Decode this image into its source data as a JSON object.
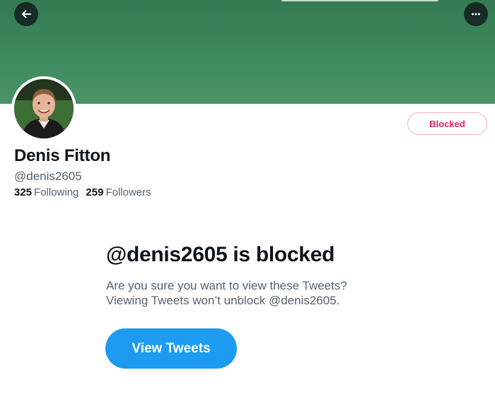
{
  "header": {
    "back_icon": "arrow-left-icon",
    "more_icon": "more-horizontal-icon",
    "banner_color": "#3f8a5f"
  },
  "profile": {
    "name": "Denis Fitton",
    "handle": "@denis2605",
    "following_count": "325",
    "following_label": "Following",
    "followers_count": "259",
    "followers_label": "Followers",
    "blocked_button_label": "Blocked",
    "blocked_color": "#e0245e"
  },
  "blocked_notice": {
    "title": "@denis2605 is blocked",
    "line1": "Are you sure you want to view these Tweets?",
    "line2": "Viewing Tweets won’t unblock @denis2605.",
    "view_button_label": "View Tweets",
    "accent_color": "#1d9bf0"
  }
}
